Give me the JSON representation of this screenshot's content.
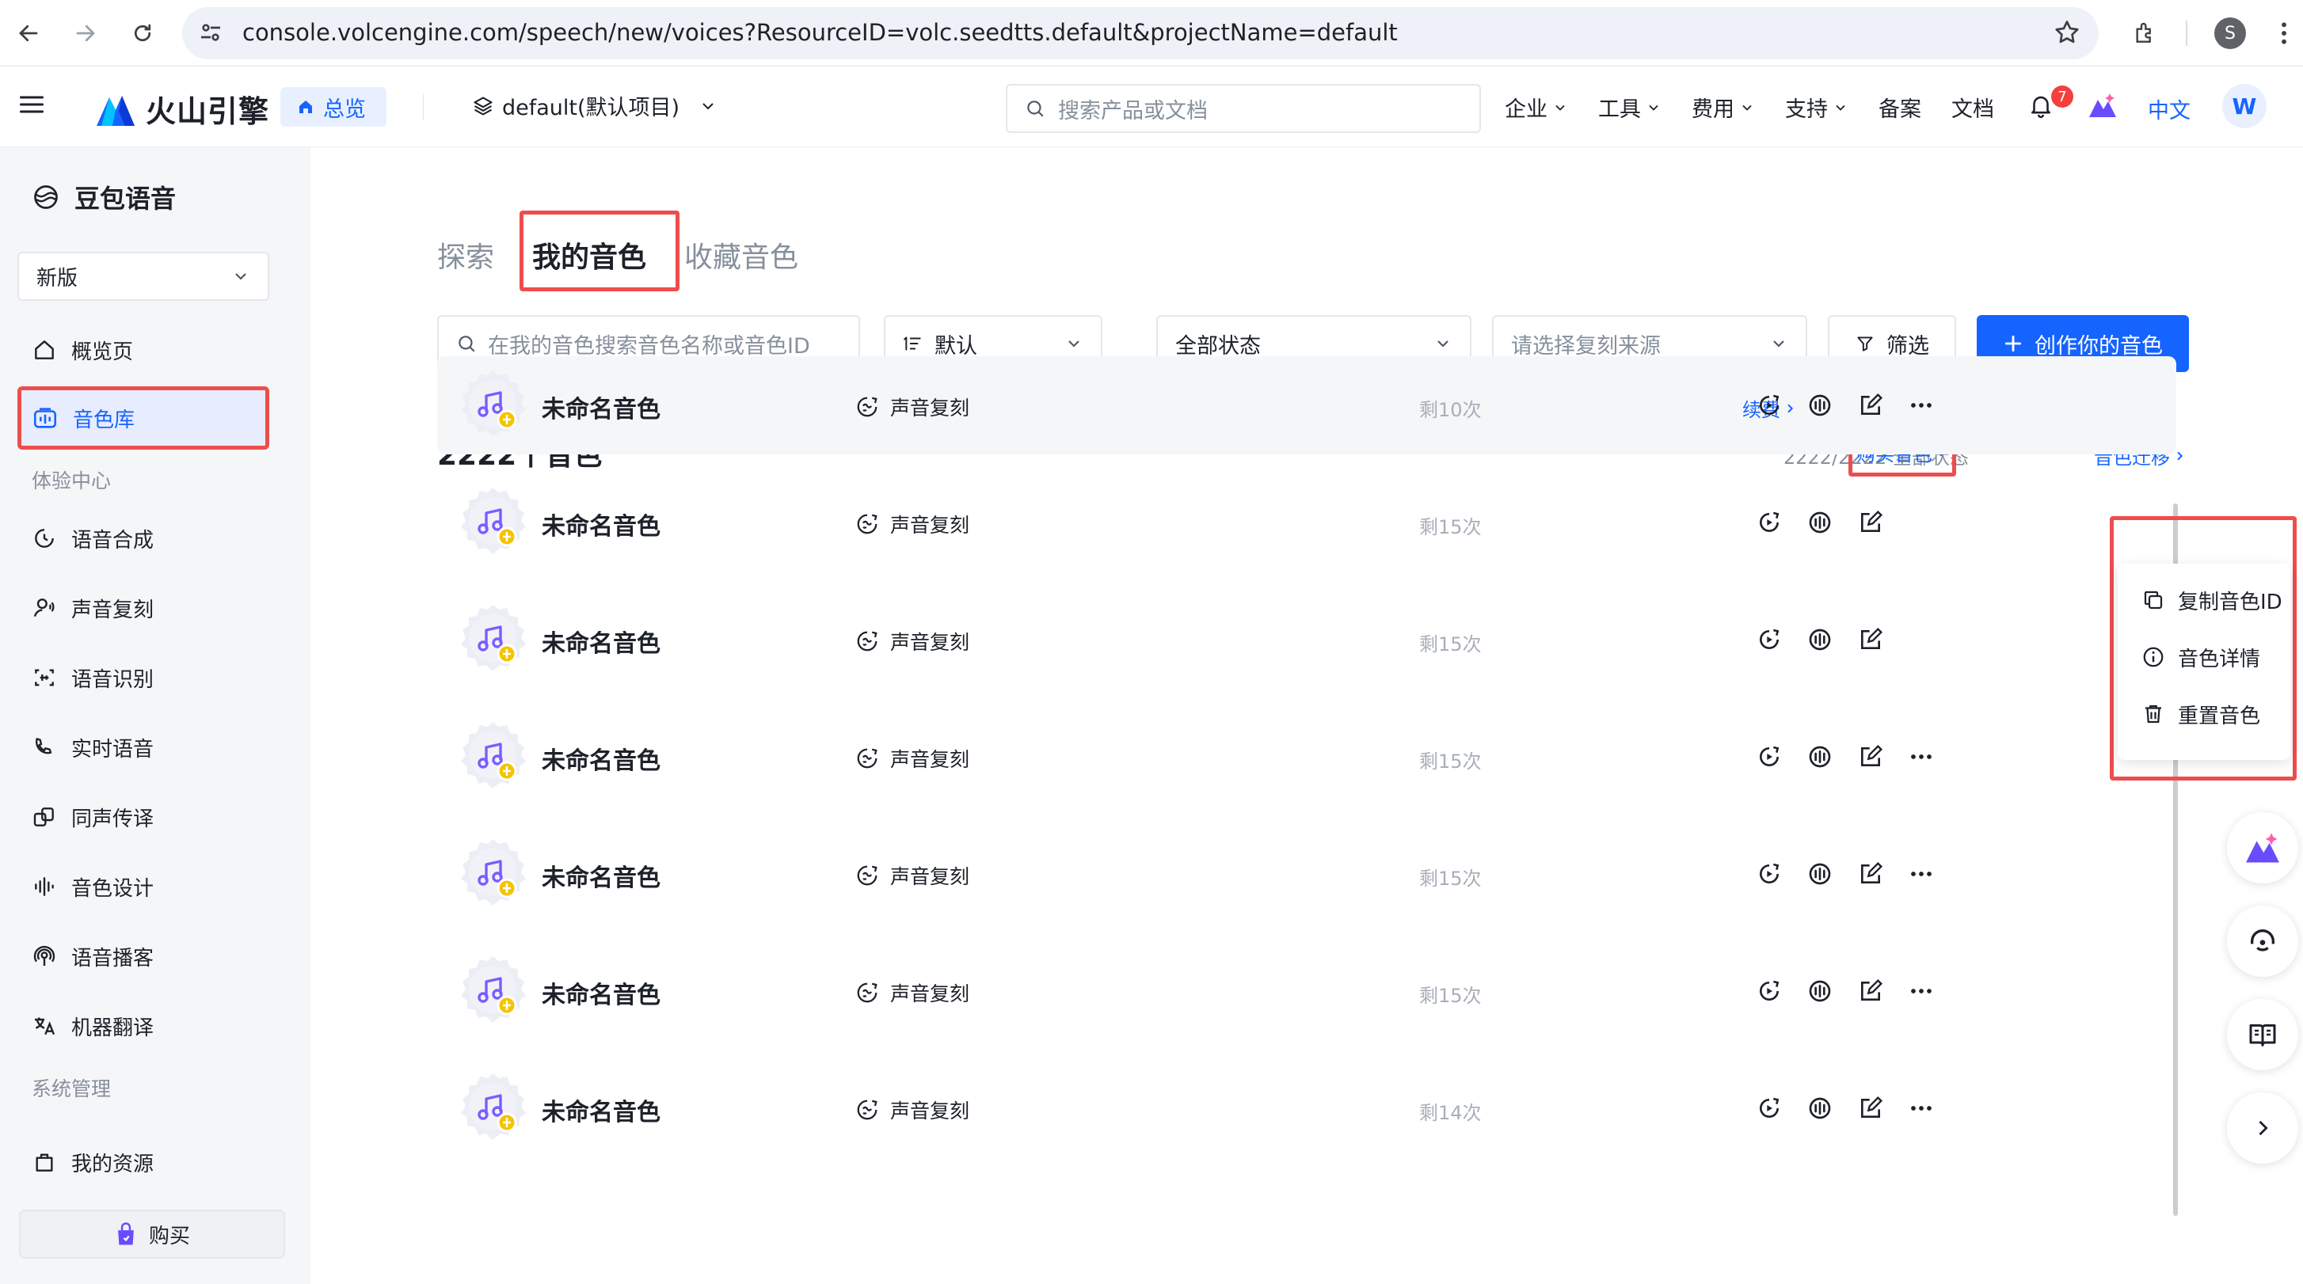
{
  "browser": {
    "url": "console.volcengine.com/speech/new/voices?ResourceID=volc.seedtts.default&projectName=default",
    "profile_initial": "S"
  },
  "header": {
    "brand_name": "火山引擎",
    "overview_tab": "总览",
    "project": "default(默认项目)",
    "search_placeholder": "搜索产品或文档",
    "nav": [
      "企业",
      "工具",
      "费用",
      "支持",
      "备案",
      "文档"
    ],
    "notification_count": "7",
    "language": "中文",
    "user_initial": "W"
  },
  "sidebar": {
    "product": "豆包语音",
    "version": "新版",
    "items": [
      {
        "label": "概览页",
        "icon": "home-icon"
      },
      {
        "label": "音色库",
        "icon": "voice-library-icon",
        "active": true
      }
    ],
    "section_experience": "体验中心",
    "experience_items": [
      {
        "label": "语音合成",
        "icon": "speech-synthesis-icon"
      },
      {
        "label": "声音复刻",
        "icon": "voice-clone-icon"
      },
      {
        "label": "语音识别",
        "icon": "speech-recognition-icon"
      },
      {
        "label": "实时语音",
        "icon": "realtime-voice-icon"
      },
      {
        "label": "同声传译",
        "icon": "simultaneous-interpretation-icon"
      },
      {
        "label": "音色设计",
        "icon": "voice-design-icon"
      },
      {
        "label": "语音播客",
        "icon": "podcast-icon"
      },
      {
        "label": "机器翻译",
        "icon": "translate-icon"
      }
    ],
    "section_system": "系统管理",
    "system_items": [
      {
        "label": "我的资源",
        "icon": "resources-icon"
      }
    ],
    "buy_label": "购买"
  },
  "main": {
    "tabs": [
      {
        "label": "探索"
      },
      {
        "label": "我的音色",
        "active": true
      },
      {
        "label": "收藏音色"
      }
    ],
    "search_placeholder": "在我的音色搜索音色名称或音色ID",
    "sort_value": "默认",
    "status_value": "全部状态",
    "source_placeholder": "请选择复刻来源",
    "filter_label": "筛选",
    "create_label": "创作你的音色",
    "count_title": "2222个音色",
    "summary": "2222/2222 全部状态",
    "buy_voice_link": "购买音色",
    "migrate_link": "音色迁移",
    "voices": [
      {
        "name": "未命名音色",
        "type": "声音复刻",
        "remaining": "剩10次",
        "renew": "续费"
      },
      {
        "name": "未命名音色",
        "type": "声音复刻",
        "remaining": "剩15次"
      },
      {
        "name": "未命名音色",
        "type": "声音复刻",
        "remaining": "剩15次"
      },
      {
        "name": "未命名音色",
        "type": "声音复刻",
        "remaining": "剩15次"
      },
      {
        "name": "未命名音色",
        "type": "声音复刻",
        "remaining": "剩15次"
      },
      {
        "name": "未命名音色",
        "type": "声音复刻",
        "remaining": "剩15次"
      },
      {
        "name": "未命名音色",
        "type": "声音复刻",
        "remaining": "剩14次"
      }
    ],
    "more_menu": [
      {
        "label": "复制音色ID",
        "icon": "copy-icon"
      },
      {
        "label": "音色详情",
        "icon": "info-icon"
      },
      {
        "label": "重置音色",
        "icon": "trash-icon"
      }
    ]
  },
  "colors": {
    "primary": "#1664ff",
    "highlight": "#ee4d4d",
    "sidebar_bg": "#f5f6f8",
    "voice_icon": "#7b5cff",
    "voice_badge": "#f5c400"
  }
}
